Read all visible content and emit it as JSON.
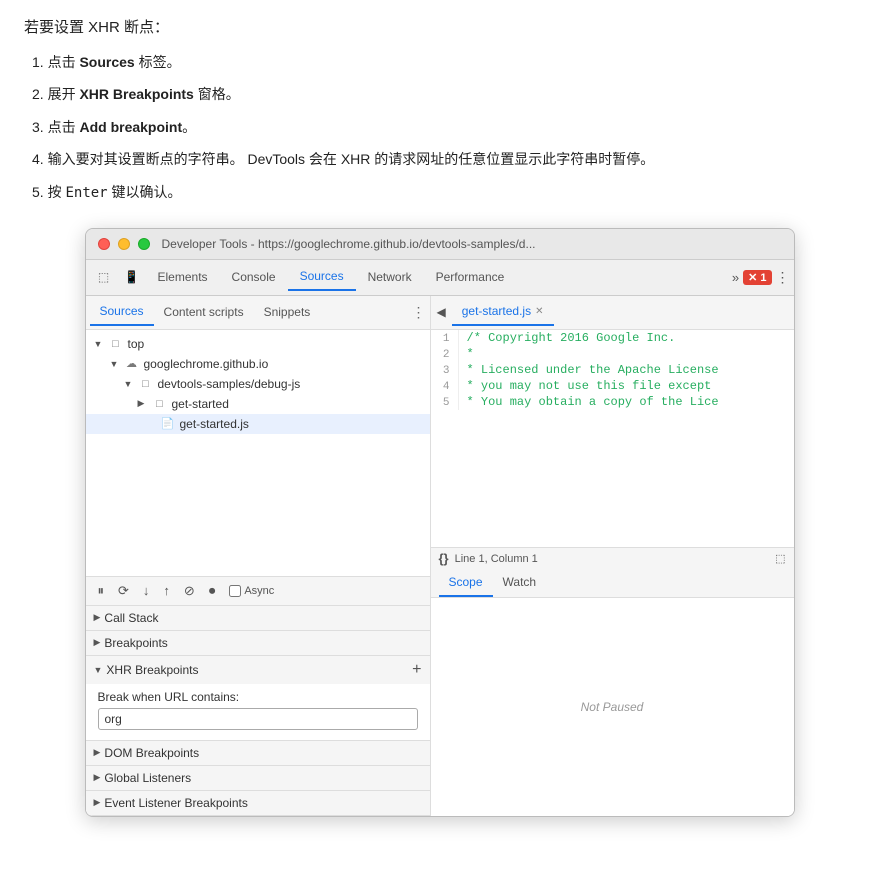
{
  "instructions": {
    "title": "若要设置 XHR 断点：",
    "steps": [
      {
        "id": 1,
        "text": "点击 ",
        "bold": "Sources",
        "suffix": " 标签。"
      },
      {
        "id": 2,
        "text": "展开 ",
        "bold": "XHR Breakpoints",
        "suffix": " 窗格。"
      },
      {
        "id": 3,
        "text": "点击 ",
        "bold": "Add breakpoint",
        "suffix": "。"
      },
      {
        "id": 4,
        "text": "输入要对其设置断点的字符串。 DevTools 会在 XHR 的请求网址的任意位置显示此字符串时暂停。"
      },
      {
        "id": 5,
        "text": "按 ",
        "code": "Enter",
        "suffix": " 键以确认。"
      }
    ]
  },
  "devtools": {
    "window_title": "Developer Tools - https://googlechrome.github.io/devtools-samples/d...",
    "top_tabs": [
      "Elements",
      "Console",
      "Sources",
      "Network",
      "Performance"
    ],
    "active_top_tab": "Sources",
    "ext_badge": "1",
    "left_panel": {
      "tabs": [
        "Sources",
        "Content scripts",
        "Snippets"
      ],
      "active_tab": "Sources",
      "file_tree": [
        {
          "level": 0,
          "type": "folder",
          "name": "top",
          "expanded": true
        },
        {
          "level": 1,
          "type": "cloud-folder",
          "name": "googlechrome.github.io",
          "expanded": true
        },
        {
          "level": 2,
          "type": "folder",
          "name": "devtools-samples/debug-js",
          "expanded": true
        },
        {
          "level": 3,
          "type": "folder",
          "name": "get-started",
          "expanded": false
        },
        {
          "level": 3,
          "type": "file-js",
          "name": "get-started.js",
          "selected": true
        }
      ],
      "toolbar_buttons": [
        "pause",
        "step-over",
        "step-into",
        "step-out",
        "skip",
        "deactivate"
      ],
      "async_label": "Async"
    },
    "bottom_panels": [
      {
        "id": "call-stack",
        "label": "Call Stack",
        "expanded": false
      },
      {
        "id": "breakpoints",
        "label": "Breakpoints",
        "expanded": false
      },
      {
        "id": "xhr-breakpoints",
        "label": "XHR Breakpoints",
        "expanded": true
      },
      {
        "id": "dom-breakpoints",
        "label": "DOM Breakpoints",
        "expanded": false
      },
      {
        "id": "global-listeners",
        "label": "Global Listeners",
        "expanded": false
      },
      {
        "id": "event-listener-breakpoints",
        "label": "Event Listener Breakpoints",
        "expanded": false
      }
    ],
    "xhr_breakpoints": {
      "label": "Break when URL contains:",
      "value": "org",
      "placeholder": ""
    },
    "right_panel": {
      "file_tab": "get-started.js",
      "code_lines": [
        {
          "num": "1",
          "content": "/* Copyright 2016 Google Inc."
        },
        {
          "num": "2",
          "content": " *"
        },
        {
          "num": "3",
          "content": " * Licensed under the Apache License"
        },
        {
          "num": "4",
          "content": " * you may not use this file except"
        },
        {
          "num": "5",
          "content": " * You may obtain a copy of the Lice"
        }
      ],
      "status_bar": {
        "braces": "{}",
        "location": "Line 1, Column 1"
      },
      "scope_tabs": [
        "Scope",
        "Watch"
      ],
      "active_scope_tab": "Scope",
      "not_paused_text": "Not Paused"
    }
  }
}
